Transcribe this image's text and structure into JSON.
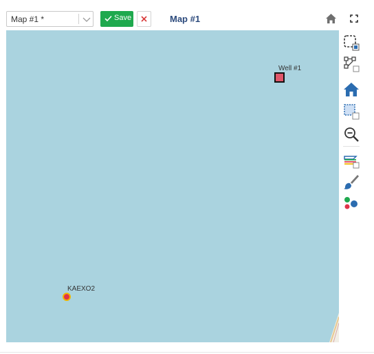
{
  "toolbar": {
    "map_select_value": "Map #1 *",
    "save_label": "Save",
    "map_title": "Map #1"
  },
  "map": {
    "background_color": "#aad3df",
    "markers": [
      {
        "label": "Well #1",
        "shape": "square",
        "color": "#e0576a"
      },
      {
        "label": "KAEXO2",
        "shape": "circle",
        "color": "#e0344a"
      }
    ]
  },
  "side_tools": [
    {
      "icon": "select-area-icon"
    },
    {
      "icon": "edit-shape-icon"
    },
    {
      "icon": "home-icon"
    },
    {
      "icon": "zoom-to-box-icon"
    },
    {
      "icon": "zoom-out-icon"
    },
    {
      "icon": "layers-icon"
    },
    {
      "icon": "style-brush-icon"
    },
    {
      "icon": "legend-dots-icon"
    }
  ],
  "colors": {
    "save_green": "#1fa94e",
    "title_blue": "#2c4a7c",
    "tool_blue": "#2b6cb0"
  }
}
